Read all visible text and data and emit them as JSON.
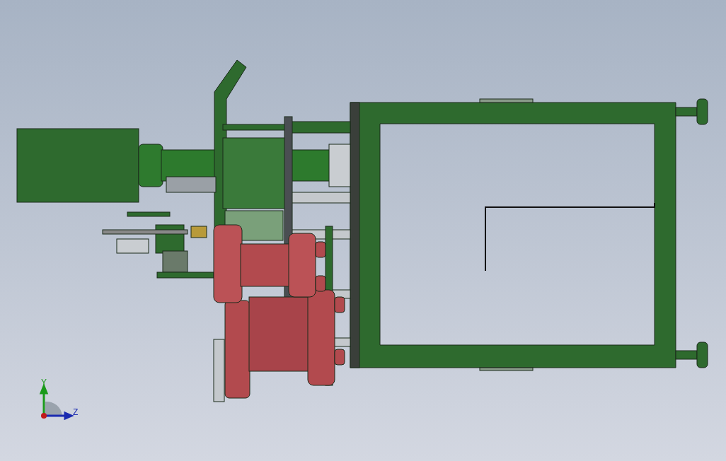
{
  "viewport": {
    "triad": {
      "labels": [
        "Y",
        "Z"
      ]
    }
  }
}
